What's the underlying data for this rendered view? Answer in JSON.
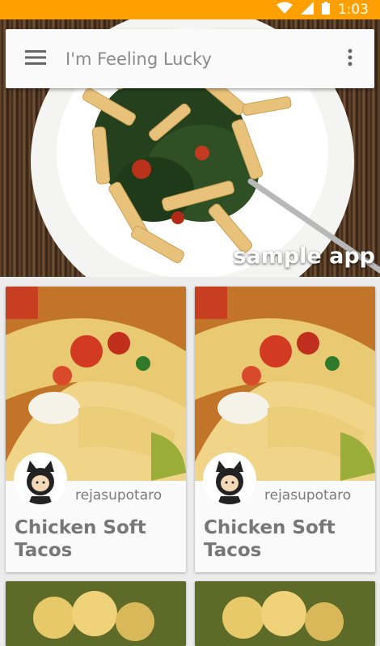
{
  "status_bar": {
    "time": "1:03",
    "color": "#ffa000"
  },
  "search": {
    "placeholder": "I'm Feeling Lucky",
    "value": ""
  },
  "hero": {
    "caption": "sample app"
  },
  "cards": [
    {
      "author": "rejasupotaro",
      "title": "Chicken Soft Tacos"
    },
    {
      "author": "rejasupotaro",
      "title": "Chicken Soft Tacos"
    }
  ],
  "icons": {
    "menu": "hamburger-icon",
    "more": "more-vert-icon"
  }
}
